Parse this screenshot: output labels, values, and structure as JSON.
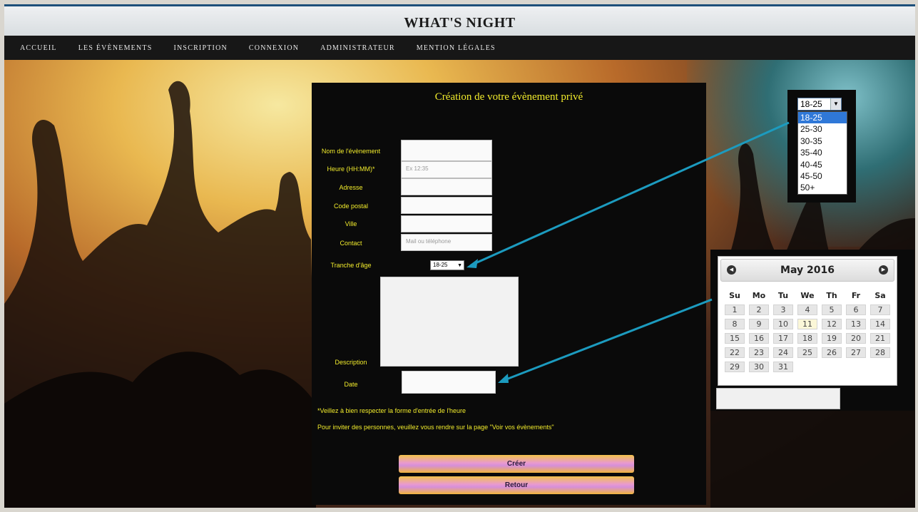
{
  "site": {
    "title": "WHAT'S NIGHT"
  },
  "nav": {
    "items": [
      "ACCUEIL",
      "LES ÉVÈNEMENTS",
      "INSCRIPTION",
      "CONNEXION",
      "ADMINISTRATEUR",
      "MENTION LÉGALES"
    ]
  },
  "form": {
    "title": "Création de votre évènement privé",
    "labels": {
      "name": "Nom de l'évènement",
      "time": "Heure (HH:MM)*",
      "address": "Adresse",
      "postal": "Code postal",
      "city": "Ville",
      "contact": "Contact",
      "age": "Tranche d'âge",
      "description": "Description",
      "date": "Date"
    },
    "placeholders": {
      "time": "Ex 12:35",
      "contact": "Mail ou téléphone"
    },
    "age_selected": "18-25",
    "note_time": "*Veillez à bien respecter la forme d'entrée de l'heure",
    "note_invite": "Pour inviter des personnes, veuillez vous rendre sur la page \"Voir vos évènements\"",
    "create_label": "Créer",
    "back_label": "Retour"
  },
  "age_dropdown": {
    "selected": "18-25",
    "options": [
      "18-25",
      "25-30",
      "30-35",
      "35-40",
      "40-45",
      "45-50",
      "50+"
    ]
  },
  "calendar": {
    "month_label": "May 2016",
    "weekdays": [
      "Su",
      "Mo",
      "Tu",
      "We",
      "Th",
      "Fr",
      "Sa"
    ],
    "weeks": [
      [
        "1",
        "2",
        "3",
        "4",
        "5",
        "6",
        "7"
      ],
      [
        "8",
        "9",
        "10",
        "11",
        "12",
        "13",
        "14"
      ],
      [
        "15",
        "16",
        "17",
        "18",
        "19",
        "20",
        "21"
      ],
      [
        "22",
        "23",
        "24",
        "25",
        "26",
        "27",
        "28"
      ],
      [
        "29",
        "30",
        "31",
        "",
        "",
        "",
        ""
      ]
    ],
    "highlighted_day": "11",
    "prev_icon": "chevron-left-icon",
    "next_icon": "chevron-right-icon"
  },
  "colors": {
    "accent_text": "#f2ec2c",
    "connector": "#1c9bbf",
    "panel": "#0a0a0a",
    "nav_bg": "#171717"
  }
}
